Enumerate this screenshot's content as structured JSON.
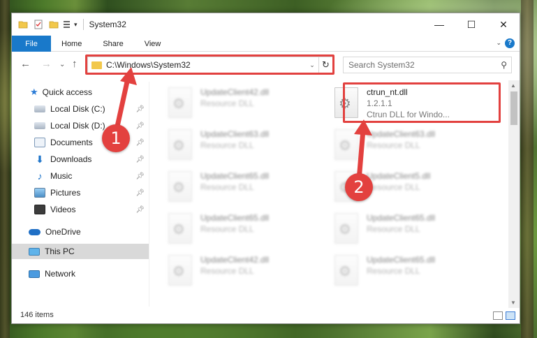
{
  "window": {
    "title": "System32",
    "quick_access_icons": [
      "folder-icon",
      "properties-icon",
      "new-folder-icon",
      "customize-icon"
    ],
    "controls": {
      "minimize": "—",
      "maximize": "☐",
      "close": "✕"
    }
  },
  "ribbon": {
    "tabs": [
      "File",
      "Home",
      "Share",
      "View"
    ],
    "expand_label": "⌄",
    "help_label": "?"
  },
  "address_bar": {
    "path": "C:\\Windows\\System32",
    "dropdown": "⌄",
    "refresh": "↻"
  },
  "nav": {
    "back": "←",
    "forward": "→",
    "recent": "⌄",
    "up": "↑"
  },
  "search": {
    "placeholder": "Search System32",
    "icon": "search-icon"
  },
  "sidebar": {
    "items": [
      {
        "label": "Quick access",
        "icon": "star-icon",
        "pinned": false
      },
      {
        "label": "Local Disk (C:)",
        "icon": "drive-icon",
        "pinned": true
      },
      {
        "label": "Local Disk (D:)",
        "icon": "drive-icon",
        "pinned": true
      },
      {
        "label": "Documents",
        "icon": "documents-icon",
        "pinned": true
      },
      {
        "label": "Downloads",
        "icon": "downloads-icon",
        "pinned": true
      },
      {
        "label": "Music",
        "icon": "music-icon",
        "pinned": true
      },
      {
        "label": "Pictures",
        "icon": "pictures-icon",
        "pinned": true
      },
      {
        "label": "Videos",
        "icon": "videos-icon",
        "pinned": true
      },
      {
        "label": "OneDrive",
        "icon": "onedrive-icon",
        "pinned": false
      },
      {
        "label": "This PC",
        "icon": "this-pc-icon",
        "pinned": false,
        "selected": true
      },
      {
        "label": "Network",
        "icon": "network-icon",
        "pinned": false
      }
    ]
  },
  "files": {
    "left_column": [
      {
        "name": "UpdateClient42.dll",
        "type": "Resource DLL"
      },
      {
        "name": "UpdateClient63.dll",
        "type": "Resource DLL"
      },
      {
        "name": "UpdateClient65.dll",
        "type": "Resource DLL"
      },
      {
        "name": "UpdateClient65.dll",
        "type": "Resource DLL"
      },
      {
        "name": "UpdateClient42.dll",
        "type": "Resource DLL"
      }
    ],
    "right_column": [
      {
        "name": "ctrun_nt.dll",
        "version": "1.2.1.1",
        "description": "Ctrun DLL for Windo..."
      },
      {
        "name": "UpdateClient63.dll",
        "type": "Resource DLL"
      },
      {
        "name": "UpdateClient5.dll",
        "type": "Resource DLL"
      },
      {
        "name": "UpdateClient65.dll",
        "type": "Resource DLL"
      },
      {
        "name": "UpdateClient65.dll",
        "type": "Resource DLL"
      }
    ]
  },
  "status": {
    "item_count": "146 items"
  },
  "annotations": {
    "step1": "1",
    "step2": "2",
    "color": "#e3413f"
  }
}
